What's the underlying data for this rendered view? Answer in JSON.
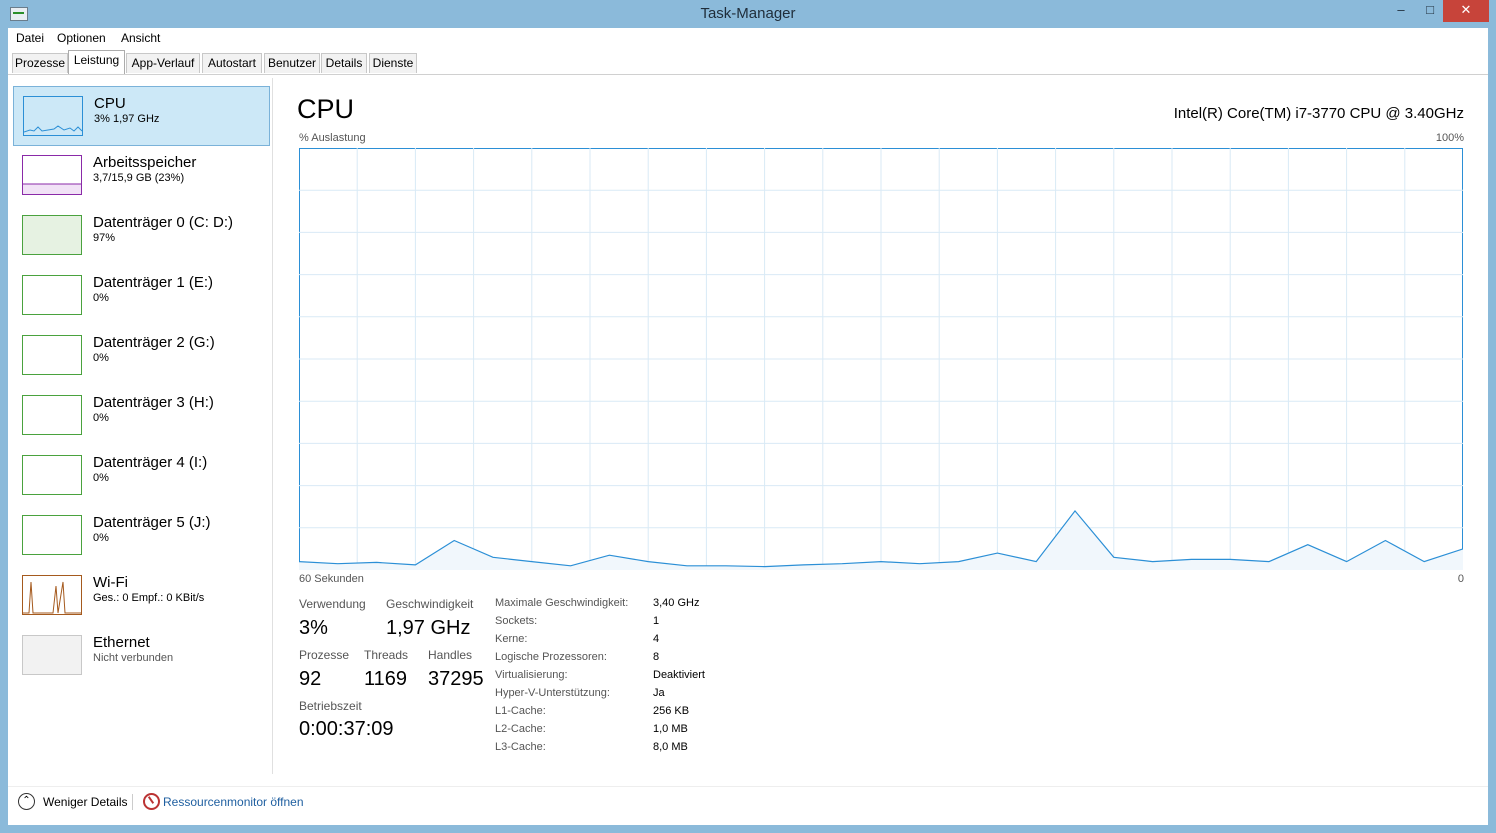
{
  "window": {
    "title": "Task-Manager"
  },
  "menu": [
    "Datei",
    "Optionen",
    "Ansicht"
  ],
  "tabs": [
    "Prozesse",
    "Leistung",
    "App-Verlauf",
    "Autostart",
    "Benutzer",
    "Details",
    "Dienste"
  ],
  "active_tab": "Leistung",
  "sidebar": [
    {
      "title": "CPU",
      "sub": "3% 1,97 GHz",
      "color": "#2b8fd6",
      "selected": true
    },
    {
      "title": "Arbeitsspeicher",
      "sub": "3,7/15,9 GB (23%)",
      "color": "#8a2aa8"
    },
    {
      "title": "Datenträger 0 (C: D:)",
      "sub": "97%",
      "color": "#4aa23e"
    },
    {
      "title": "Datenträger 1 (E:)",
      "sub": "0%",
      "color": "#4aa23e"
    },
    {
      "title": "Datenträger 2 (G:)",
      "sub": "0%",
      "color": "#4aa23e"
    },
    {
      "title": "Datenträger 3 (H:)",
      "sub": "0%",
      "color": "#4aa23e"
    },
    {
      "title": "Datenträger 4 (I:)",
      "sub": "0%",
      "color": "#4aa23e"
    },
    {
      "title": "Datenträger 5 (J:)",
      "sub": "0%",
      "color": "#4aa23e"
    },
    {
      "title": "Wi-Fi",
      "sub": "Ges.: 0 Empf.: 0 KBit/s",
      "color": "#a55a1e"
    },
    {
      "title": "Ethernet",
      "sub": "Nicht verbunden",
      "color": "#bcbcbc"
    }
  ],
  "main": {
    "title": "CPU",
    "cpu_name": "Intel(R) Core(TM) i7-3770 CPU @ 3.40GHz",
    "y_label": "% Auslastung",
    "y_max_label": "100%",
    "x_label": "60 Sekunden",
    "x_min_label": "0"
  },
  "chart_data": {
    "type": "area",
    "x": [
      60,
      58,
      56,
      54,
      52,
      50,
      48,
      46,
      44,
      42,
      40,
      38,
      36,
      34,
      32,
      30,
      28,
      26,
      24,
      22,
      20,
      18,
      16,
      14,
      12,
      10,
      8,
      6,
      4,
      2,
      0
    ],
    "series": [
      {
        "values": [
          2,
          1.5,
          1.8,
          1.2,
          7,
          3,
          2,
          1,
          3.5,
          2,
          1,
          1,
          0.8,
          1.2,
          1.5,
          2,
          1.5,
          2,
          4,
          2,
          14,
          3,
          2,
          2.5,
          2.5,
          2,
          6,
          2,
          7,
          2,
          5
        ]
      }
    ],
    "ylim": [
      0,
      100
    ],
    "xlim": [
      60,
      0
    ],
    "color": "#2b8fd6",
    "grid": true
  },
  "stats": {
    "usage_label": "Verwendung",
    "usage": "3%",
    "speed_label": "Geschwindigkeit",
    "speed": "1,97 GHz",
    "processes_label": "Prozesse",
    "processes": "92",
    "threads_label": "Threads",
    "threads": "1169",
    "handles_label": "Handles",
    "handles": "37295",
    "uptime_label": "Betriebszeit",
    "uptime": "0:00:37:09"
  },
  "info": [
    {
      "label": "Maximale Geschwindigkeit:",
      "value": "3,40 GHz"
    },
    {
      "label": "Sockets:",
      "value": "1"
    },
    {
      "label": "Kerne:",
      "value": "4"
    },
    {
      "label": "Logische Prozessoren:",
      "value": "8"
    },
    {
      "label": "Virtualisierung:",
      "value": "Deaktiviert"
    },
    {
      "label": "Hyper-V-Unterstützung:",
      "value": "Ja"
    },
    {
      "label": "L1-Cache:",
      "value": "256 KB"
    },
    {
      "label": "L2-Cache:",
      "value": "1,0 MB"
    },
    {
      "label": "L3-Cache:",
      "value": "8,0 MB"
    }
  ],
  "footer": {
    "fewer_details": "Weniger Details",
    "resource_monitor": "Ressourcenmonitor öffnen"
  }
}
